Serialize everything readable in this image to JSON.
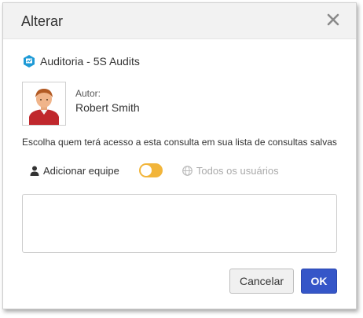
{
  "dialog": {
    "title": "Alterar",
    "close_icon": "close-icon"
  },
  "breadcrumb": {
    "icon": "audit-report-icon",
    "text": "Auditoria - 5S Audits"
  },
  "author": {
    "label": "Autor:",
    "name": "Robert Smith",
    "avatar_icon": "user-avatar-icon"
  },
  "description": "Escolha quem terá acesso a esta consulta em sua lista de consultas salvas",
  "share": {
    "team_label": "Adicionar equipe",
    "team_icon": "user-icon",
    "toggle_on": false,
    "all_users_label": "Todos os usuários",
    "all_users_icon": "globe-icon"
  },
  "textarea": {
    "value": ""
  },
  "buttons": {
    "cancel": "Cancelar",
    "ok": "OK"
  },
  "colors": {
    "toggle": "#f2b53a",
    "primary": "#3556c8",
    "header_bg": "#f2f2f2"
  }
}
